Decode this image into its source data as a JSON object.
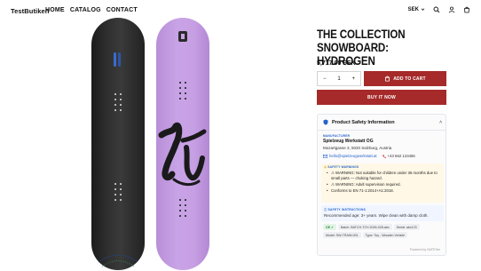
{
  "header": {
    "logo": "TestButiken",
    "nav": [
      "HOME",
      "CATALOG",
      "CONTACT"
    ],
    "currency": "SEK",
    "icons": [
      "search-icon",
      "account-icon",
      "cart-icon"
    ]
  },
  "product": {
    "title": "THE COLLECTION SNOWBOARD: HYDROGEN",
    "price": "5,717.00 SEK",
    "quantity": "1",
    "qty_minus": "−",
    "qty_plus": "+",
    "add_to_cart": "ADD TO CART",
    "buy_now": "BUY IT NOW"
  },
  "safety": {
    "heading": "Product Safety Information",
    "manufacturer_label": "MANUFACTURER",
    "manufacturer_name": "Spielzeug Werkstatt OG",
    "address": "Mozartgasse 3, 5020 Salzburg, Austria",
    "email": "hello@spielzeugwerkstatt.at",
    "phone": "+43 662 123456",
    "warnings_label": "SAFETY WARNINGS",
    "warnings": [
      "⚠ WARNING: Not suitable for children under 36 months due to small parts — choking hazard.",
      "⚠ WARNING: Adult supervision required.",
      "Conforms to EN 71-1:2014+A1:2018."
    ],
    "instructions_label": "SAFETY INSTRUCTIONS",
    "instructions": "Recommended age: 3+ years. Wipe clean with damp cloth.",
    "chips": {
      "ce": "CE ✓",
      "batch": "Batch: BATCH-TOY-2026-028-abc",
      "serial": "Serial: abc123",
      "model": "Model: SW-TRAIN-001",
      "type": "Type: Toy - Wooden Vehicle"
    },
    "powered_by": "Powered by SAFETee"
  },
  "colors": {
    "accent": "#a62a2a",
    "link": "#2563c9",
    "board_purple": "#c7a0e4",
    "board_black": "#2f2f2f"
  }
}
